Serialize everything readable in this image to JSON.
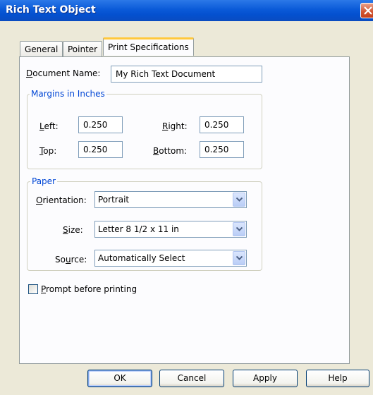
{
  "window": {
    "title": "Rich Text Object"
  },
  "tabs": [
    {
      "label": "General",
      "active": false
    },
    {
      "label": "Pointer",
      "active": false
    },
    {
      "label": "Print Specifications",
      "active": true
    }
  ],
  "document_name": {
    "label": "Document Name:",
    "value": "My Rich Text Document"
  },
  "margins": {
    "title": "Margins in Inches",
    "left": {
      "label": "Left:",
      "value": "0.250"
    },
    "right": {
      "label": "Right:",
      "value": "0.250"
    },
    "top": {
      "label": "Top:",
      "value": "0.250"
    },
    "bottom": {
      "label": "Bottom:",
      "value": "0.250"
    }
  },
  "paper": {
    "title": "Paper",
    "orientation": {
      "label": "Orientation:",
      "value": "Portrait"
    },
    "size": {
      "label": "Size:",
      "value": "Letter 8 1/2 x 11 in"
    },
    "source": {
      "label": "Source:",
      "value": "Automatically Select"
    }
  },
  "prompt_checkbox": {
    "label": "Prompt before printing",
    "checked": false
  },
  "buttons": {
    "ok": "OK",
    "cancel": "Cancel",
    "apply": "Apply",
    "help": "Help"
  },
  "colors": {
    "title_bar": "#0a5ad8",
    "group_title": "#0046d5",
    "tab_highlight": "#ffc83c"
  }
}
